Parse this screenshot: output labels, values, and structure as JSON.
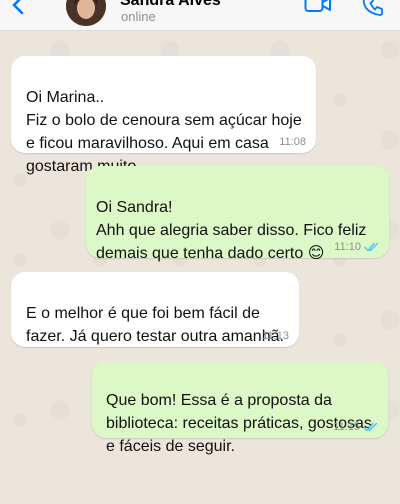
{
  "header": {
    "contact_name": "Sandra Alves",
    "status": "online",
    "accent_color": "#007aff",
    "icons": [
      "back-chevron-icon",
      "video-call-icon",
      "voice-call-icon"
    ]
  },
  "messages": [
    {
      "direction": "incoming",
      "text": "Oi Marina..\nFiz o bolo de cenoura sem açúcar hoje e ficou maravilhoso. Aqui em casa gostaram muito.",
      "time": "11:08"
    },
    {
      "direction": "outgoing",
      "text": "Oi Sandra!\nAhh que alegria saber disso. Fico feliz demais que tenha dado certo 😊",
      "time": "11:10",
      "status": "read"
    },
    {
      "direction": "incoming",
      "text": "E o melhor é que foi bem fácil de fazer. Já quero testar outra amanhã.",
      "time": "11:13"
    },
    {
      "direction": "outgoing",
      "text": "Que bom! Essa é a proposta da biblioteca: receitas práticas, gostosas e fáceis de seguir.",
      "time": "11:15",
      "status": "read"
    }
  ],
  "colors": {
    "incoming_bubble": "#ffffff",
    "outgoing_bubble": "#dcf8c6",
    "read_ticks": "#4fc3f7",
    "chat_background": "#ece5dd"
  }
}
